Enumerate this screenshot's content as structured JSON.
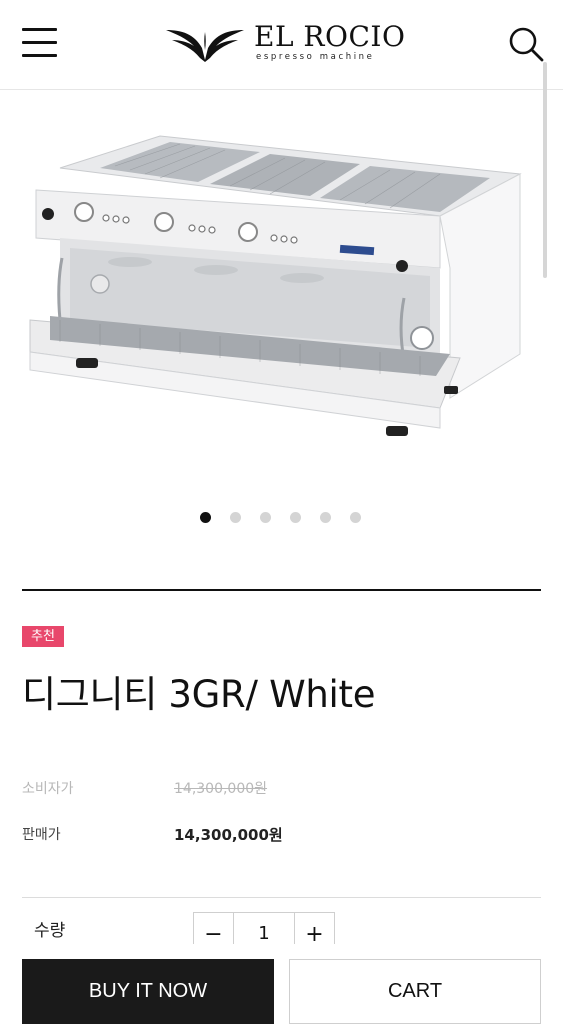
{
  "header": {
    "brand_name": "EL ROCIO",
    "brand_tagline": "espresso machine",
    "menu_icon": "hamburger-menu-icon",
    "search_icon": "search-icon"
  },
  "gallery": {
    "image_alt": "디그니티 3GR/ White",
    "slide_count": 6,
    "active_slide": 1
  },
  "product": {
    "badge": "추천",
    "badge_color": "#e8476b",
    "title": "디그니티 3GR/ White",
    "consumer_price_label": "소비자가",
    "consumer_price": "14,300,000원",
    "sale_price_label": "판매가",
    "sale_price": "14,300,000원"
  },
  "quantity": {
    "label": "수량",
    "decrement": "−",
    "value": "1",
    "increment": "+"
  },
  "actions": {
    "buy_now": "BUY IT NOW",
    "cart": "CART"
  }
}
